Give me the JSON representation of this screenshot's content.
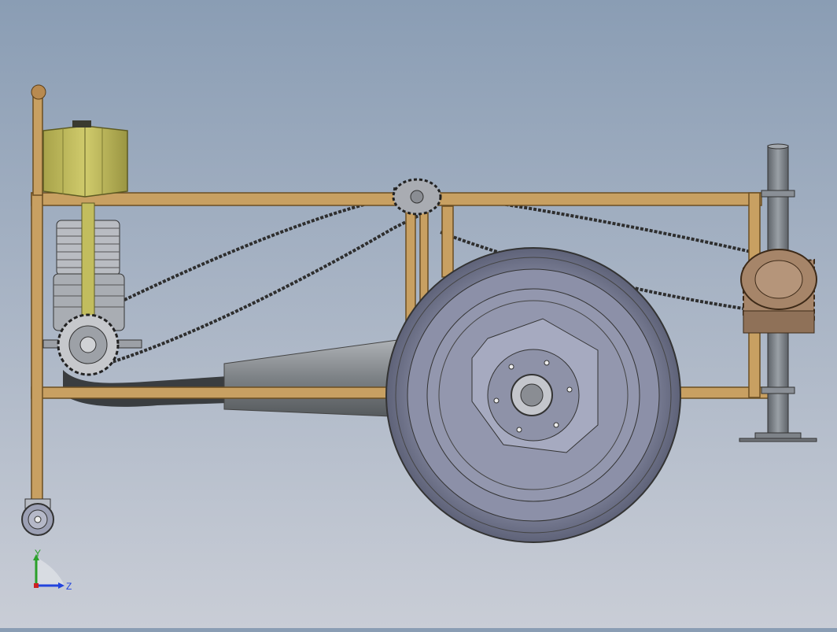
{
  "viewport": {
    "background_top": "#8a9db4",
    "background_bottom": "#c9cdd6",
    "frame_color": "#c8a062",
    "frame_edge": "#6b4e22",
    "fuel_tank_color": "#c2bd5e",
    "wheel_color": "#8c90a8",
    "gear_color": "#a68569",
    "shaft_color": "#8a8f96"
  },
  "triad": {
    "y_label": "Y",
    "z_label": "Z",
    "y_axis_color": "#2aa02a",
    "z_axis_color": "#2244dd"
  }
}
